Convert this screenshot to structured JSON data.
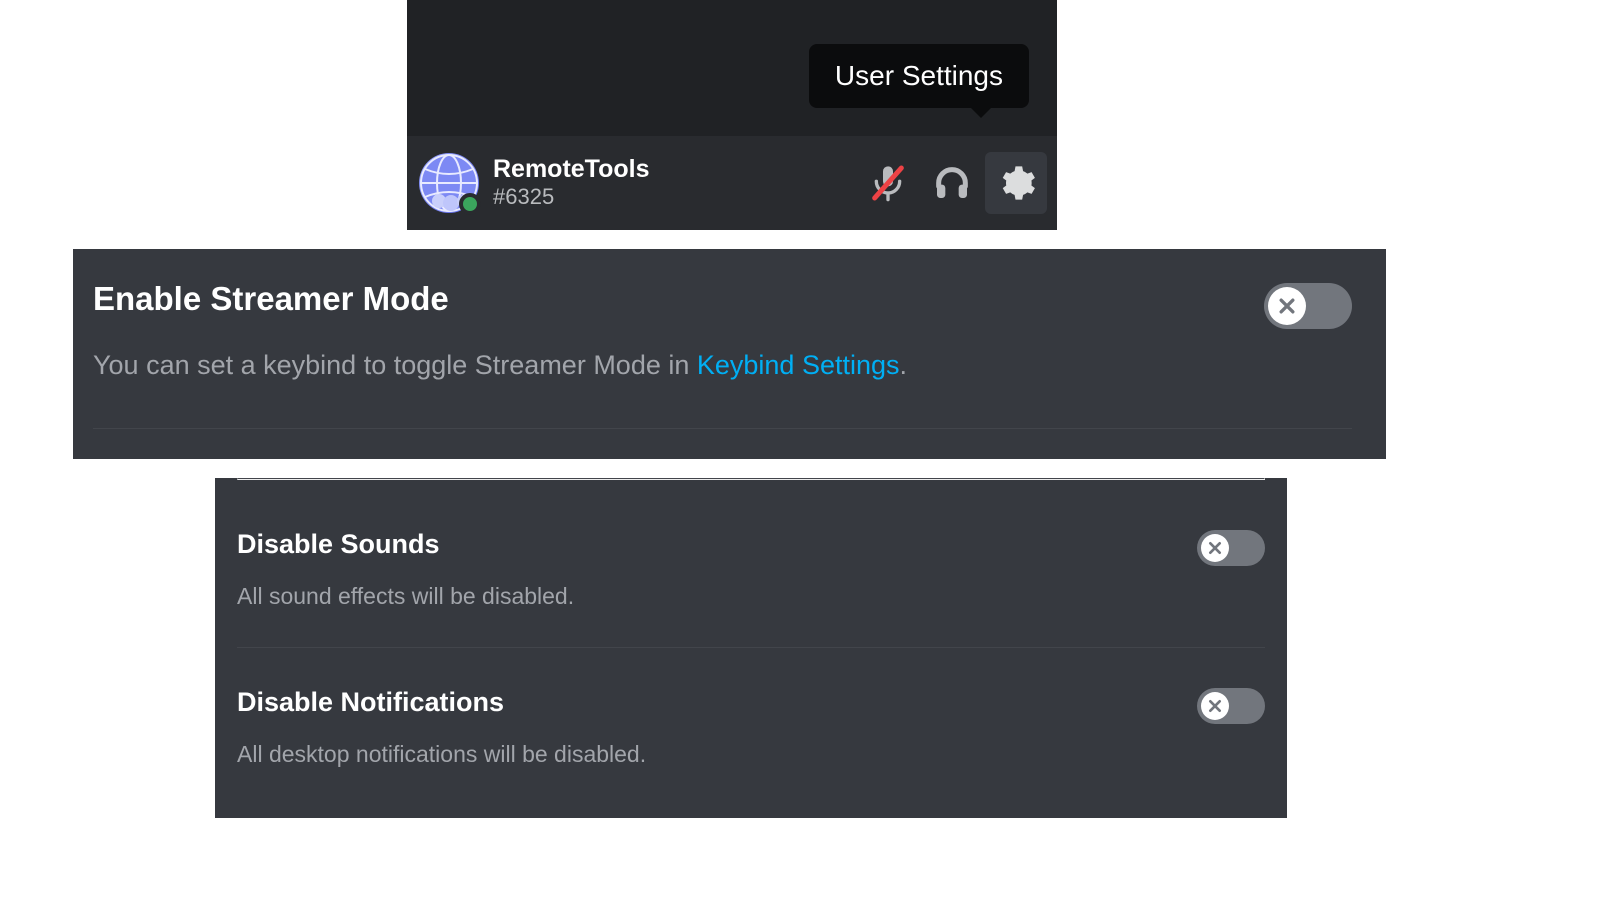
{
  "colors": {
    "accent_link": "#00aff4",
    "status_online": "#3ba55d",
    "toggle_off_bg": "#72767d",
    "panel_bg": "#36393f"
  },
  "tooltip": {
    "label": "User Settings"
  },
  "user": {
    "name": "RemoteTools",
    "discriminator": "#6325",
    "status": "online"
  },
  "icons": {
    "mic": "mic-muted-icon",
    "headphones": "headphones-icon",
    "settings": "gear-icon"
  },
  "settings": {
    "streamer_mode": {
      "title": "Enable Streamer Mode",
      "desc_prefix": "You can set a keybind to toggle Streamer Mode in ",
      "desc_link": "Keybind Settings",
      "desc_suffix": ".",
      "toggled": false
    },
    "disable_sounds": {
      "title": "Disable Sounds",
      "desc": "All sound effects will be disabled.",
      "toggled": false
    },
    "disable_notifications": {
      "title": "Disable Notifications",
      "desc": "All desktop notifications will be disabled.",
      "toggled": false
    }
  }
}
